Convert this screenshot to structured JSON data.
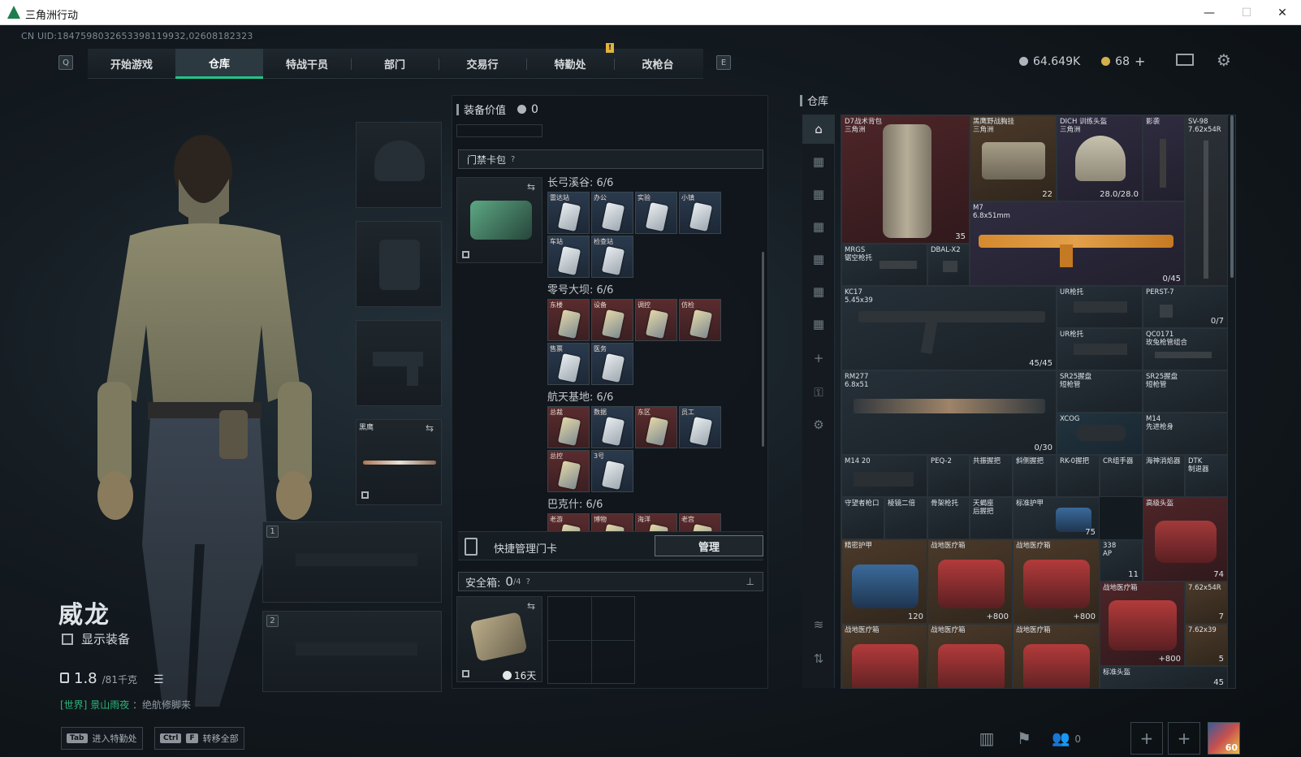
{
  "window": {
    "title": "三角洲行动",
    "minimize": "—",
    "maximize": "☐",
    "close": "✕"
  },
  "uid": "CN UID:1847598032653398119932,02608182323",
  "nav": {
    "left_key": "Q",
    "right_key": "E",
    "tabs": [
      "开始游戏",
      "仓库",
      "特战干员",
      "部门",
      "交易行",
      "特勤处",
      "改枪台"
    ],
    "active": "仓库",
    "notice": "!"
  },
  "currency": {
    "money": "64.649K",
    "coupon": "68",
    "add": "+"
  },
  "character": {
    "name": "威龙",
    "show_equipment": "显示装备",
    "weight": "1.8",
    "weight_max": "/81千克"
  },
  "chat": {
    "channel": "[世界]",
    "name": "景山雨夜",
    "message": "：绝航修脚来"
  },
  "hints": [
    {
      "keys": [
        "Tab"
      ],
      "label": "进入特勤处"
    },
    {
      "keys": [
        "Ctrl",
        "F"
      ],
      "label": "转移全部"
    }
  ],
  "equip_slots": {
    "melee_label": "黑鹰",
    "slot1": "1",
    "slot2": "2"
  },
  "loadout": {
    "value_label": "装备价值",
    "value": "0",
    "keycase": "门禁卡包",
    "help": "?",
    "maps": [
      {
        "title": "长弓溪谷: 6/6",
        "cards": [
          "雷达站",
          "办公",
          "实验",
          "小镇",
          "车站",
          "检查站"
        ]
      },
      {
        "title": "零号大坝: 6/6",
        "cards": [
          "东楼",
          "设备",
          "调控",
          "仿检",
          "售票",
          "医务"
        ]
      },
      {
        "title": "航天基地: 6/6",
        "cards": [
          "总裁",
          "数据",
          "东区",
          "员工",
          "总控",
          "3号"
        ]
      },
      {
        "title": "巴克什: 6/6",
        "cards": [
          "老游",
          "博物",
          "海洋",
          "老宫"
        ]
      }
    ],
    "quick_manage": "快捷管理门卡",
    "manage_btn": "管理",
    "safe_box": "安全箱:",
    "safe_box_count": "0",
    "safe_box_max": "/4",
    "safe_days": "16天"
  },
  "warehouse": {
    "title": "仓库",
    "items": [
      {
        "name": "D7战术背包",
        "sub": "三角洲",
        "count": "35"
      },
      {
        "name": "黑鹰野战胸挂",
        "sub": "三角洲",
        "count": "22"
      },
      {
        "name": "DICH 训练头盔",
        "sub": "三角洲",
        "count": "28.0/28.0"
      },
      {
        "name": "影袭",
        "sub": "",
        "count": ""
      },
      {
        "name": "SV-98",
        "sub": "7.62x54R",
        "count": ""
      },
      {
        "name": "M7",
        "sub": "6.8x51mm",
        "count": "0/45"
      },
      {
        "name": "MRGS",
        "sub": "锯空枪托",
        "count": ""
      },
      {
        "name": "DBAL-X2",
        "sub": "",
        "count": ""
      },
      {
        "name": "KC17",
        "sub": "5.45x39",
        "count": "45/45"
      },
      {
        "name": "UR枪托",
        "sub": "",
        "count": ""
      },
      {
        "name": "PERST-7",
        "sub": "",
        "count": "0/7"
      },
      {
        "name": "UR枪托",
        "sub": "",
        "count": ""
      },
      {
        "name": "QC0171",
        "sub": "玫兔枪管组合",
        "count": ""
      },
      {
        "name": "RM277",
        "sub": "6.8x51",
        "count": "0/30"
      },
      {
        "name": "SR25握盘",
        "sub": "短枪管",
        "count": ""
      },
      {
        "name": "SR25握盘",
        "sub": "短枪管",
        "count": ""
      },
      {
        "name": "XCOG",
        "sub": "",
        "count": ""
      },
      {
        "name": "M14",
        "sub": "先进枪身",
        "count": ""
      },
      {
        "name": "M14 20",
        "sub": "",
        "count": ""
      },
      {
        "name": "PEQ-2",
        "sub": "",
        "count": ""
      },
      {
        "name": "共振握把",
        "sub": "",
        "count": ""
      },
      {
        "name": "斜侧握把",
        "sub": "",
        "count": ""
      },
      {
        "name": "RK-0握把",
        "sub": "",
        "count": ""
      },
      {
        "name": "CR组手器",
        "sub": "",
        "count": ""
      },
      {
        "name": "海神消焰器",
        "sub": "",
        "count": ""
      },
      {
        "name": "DTK",
        "sub": "制退器",
        "count": ""
      },
      {
        "name": "守望者枪口",
        "sub": "",
        "count": ""
      },
      {
        "name": "棱镜二倍",
        "sub": "",
        "count": ""
      },
      {
        "name": "骨架枪托",
        "sub": "",
        "count": ""
      },
      {
        "name": "天蝎座",
        "sub": "后握把",
        "count": ""
      },
      {
        "name": "标准护甲",
        "sub": "",
        "count": "75"
      },
      {
        "name": "高级头盔",
        "sub": "",
        "count": "74"
      },
      {
        "name": "精密护甲",
        "sub": "",
        "count": "120"
      },
      {
        "name": "战地医疗箱",
        "sub": "",
        "count": "+800"
      },
      {
        "name": "战地医疗箱",
        "sub": "",
        "count": "+800"
      },
      {
        "name": "338",
        "sub": "AP",
        "count": "11"
      },
      {
        "name": "战地医疗箱",
        "sub": "",
        "count": "+800"
      },
      {
        "name": "7.62x54R",
        "sub": "",
        "count": "7"
      },
      {
        "name": "7.62x39",
        "sub": "",
        "count": "5"
      },
      {
        "name": "战地医疗箱",
        "sub": "",
        "count": ""
      },
      {
        "name": "战地医疗箱",
        "sub": "",
        "count": ""
      },
      {
        "name": "战地医疗箱",
        "sub": "",
        "count": ""
      },
      {
        "name": "标准头盔",
        "sub": "",
        "count": "45"
      }
    ]
  },
  "bottom_right": {
    "friends": "0",
    "add": "+",
    "level": "60"
  },
  "colors": {
    "accent": "#23c489",
    "bg": "#141b21",
    "rare_red": "#4e2528",
    "rare_purple": "#2f2c40"
  }
}
